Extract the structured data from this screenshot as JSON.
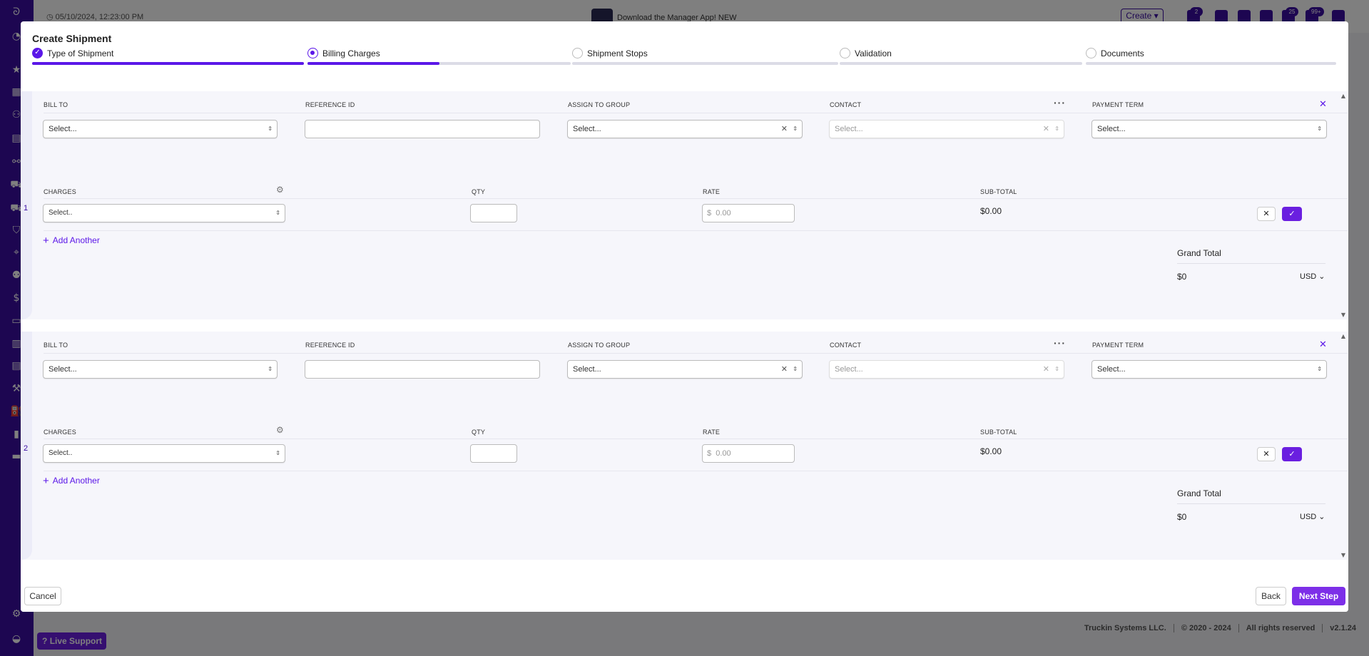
{
  "header": {
    "timestamp": "05/10/2024, 12:23:00 PM",
    "promo": "Download the Manager App! NEW",
    "create_label": "Create",
    "badges": [
      "2",
      "25",
      "99+"
    ]
  },
  "footer": {
    "company": "Truckin Systems LLC.",
    "years": "© 2020 - 2024",
    "rights": "All rights reserved",
    "version": "v2.1.24",
    "live_support": "Live Support"
  },
  "modal": {
    "title": "Create Shipment",
    "steps": [
      {
        "label": "Type of Shipment",
        "state": "done",
        "progress": 1.0
      },
      {
        "label": "Billing Charges",
        "state": "active",
        "progress": 0.5
      },
      {
        "label": "Shipment Stops",
        "state": "pending",
        "progress": 0
      },
      {
        "label": "Validation",
        "state": "pending",
        "progress": 0
      },
      {
        "label": "Documents",
        "state": "pending",
        "progress": 0
      }
    ],
    "cancel_label": "Cancel",
    "back_label": "Back",
    "next_label": "Next Step"
  },
  "billing_blocks": [
    {
      "number": "1",
      "labels": {
        "bill_to": "BILL TO",
        "reference_id": "REFERENCE ID",
        "assign_group": "ASSIGN TO GROUP",
        "contact": "CONTACT",
        "payment_term": "PAYMENT TERM"
      },
      "bill_to": "Select...",
      "reference_id": "",
      "assign_group": "Select...",
      "contact": "Select...",
      "payment_term": "Select...",
      "charge_labels": {
        "charges": "CHARGES",
        "qty": "QTY",
        "rate": "RATE",
        "subtotal": "SUB-TOTAL"
      },
      "charge": "Select..",
      "qty": "",
      "rate_prefix": "$",
      "rate_placeholder": "0.00",
      "subtotal": "$0.00",
      "add_another": "Add Another",
      "grand_total_label": "Grand Total",
      "grand_total": "$0",
      "currency": "USD"
    },
    {
      "number": "2",
      "labels": {
        "bill_to": "BILL TO",
        "reference_id": "REFERENCE ID",
        "assign_group": "ASSIGN TO GROUP",
        "contact": "CONTACT",
        "payment_term": "PAYMENT TERM"
      },
      "bill_to": "Select...",
      "reference_id": "",
      "assign_group": "Select...",
      "contact": "Select...",
      "payment_term": "Select...",
      "charge_labels": {
        "charges": "CHARGES",
        "qty": "QTY",
        "rate": "RATE",
        "subtotal": "SUB-TOTAL"
      },
      "charge": "Select..",
      "qty": "",
      "rate_prefix": "$",
      "rate_placeholder": "0.00",
      "subtotal": "$0.00",
      "add_another": "Add Another",
      "grand_total_label": "Grand Total",
      "grand_total": "$0",
      "currency": "USD"
    }
  ]
}
